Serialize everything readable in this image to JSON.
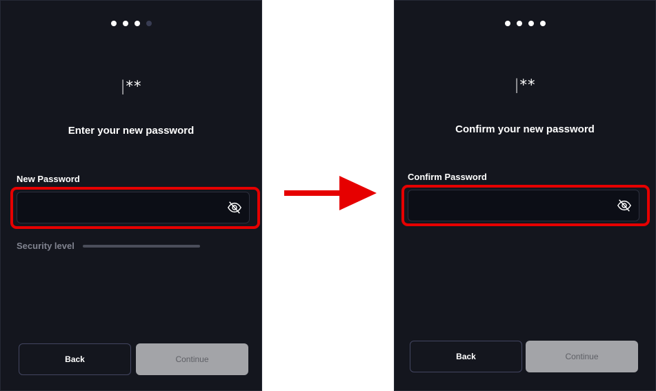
{
  "left_screen": {
    "step_dots": {
      "total": 4,
      "active": 3
    },
    "password_glyph": {
      "cursor": "|",
      "mask": "**"
    },
    "heading": "Enter your new password",
    "field_label": "New Password",
    "input_value": "",
    "visibility_icon": "eye-slash-icon",
    "security_label": "Security level",
    "back_label": "Back",
    "continue_label": "Continue"
  },
  "right_screen": {
    "step_dots": {
      "total": 4,
      "active": 4
    },
    "password_glyph": {
      "cursor": "|",
      "mask": "**"
    },
    "heading": "Confirm your new password",
    "field_label": "Confirm Password",
    "input_value": "",
    "visibility_icon": "eye-slash-icon",
    "back_label": "Back",
    "continue_label": "Continue"
  },
  "annotation": {
    "arrow_icon": "right-arrow-icon",
    "highlight_color": "#e60000"
  },
  "colors": {
    "panel_background": "#14161e",
    "input_background": "#0c0e16",
    "continue_disabled": "#a3a4a8",
    "back_border": "#434661",
    "inactive_dot": "#383c52"
  }
}
